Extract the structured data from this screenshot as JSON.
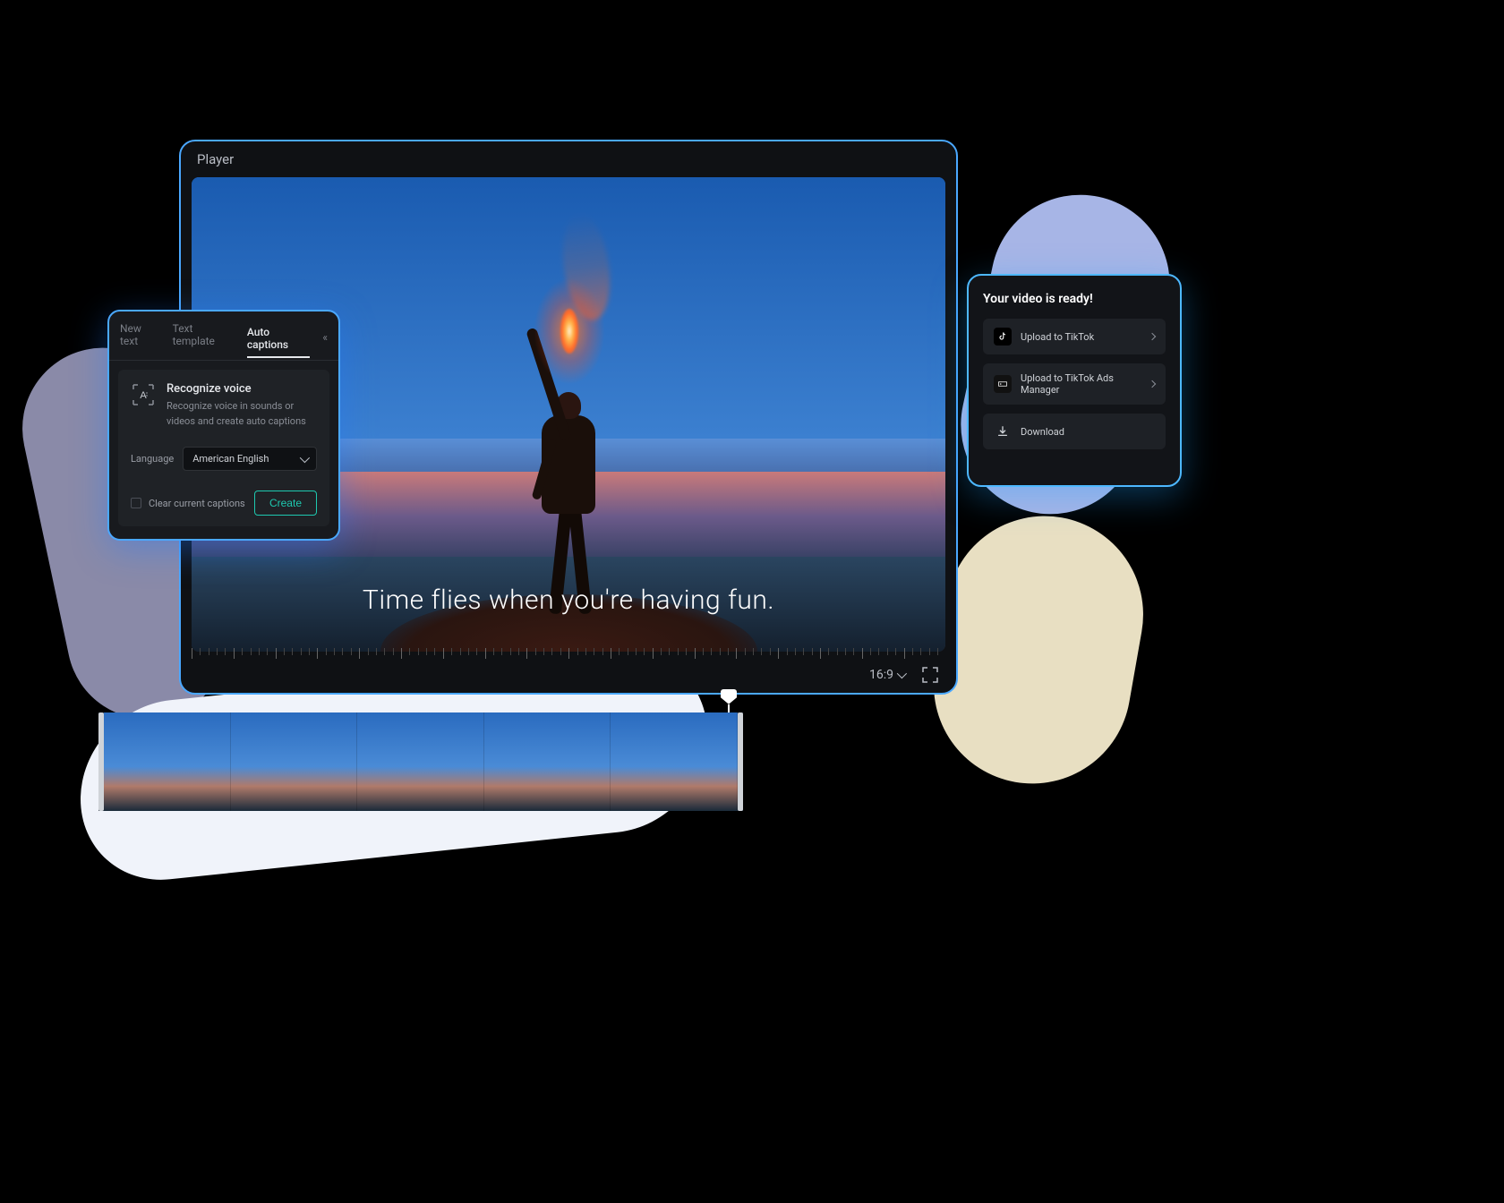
{
  "player": {
    "title": "Player",
    "caption": "Time flies when you're having fun.",
    "aspect_ratio": "16:9"
  },
  "captions_panel": {
    "tabs": [
      "New text",
      "Text template",
      "Auto captions"
    ],
    "active_tab": "Auto captions",
    "recognize": {
      "title": "Recognize voice",
      "description": "Recognize voice in sounds or videos and create auto captions"
    },
    "language_label": "Language",
    "language_value": "American English",
    "clear_label": "Clear current captions",
    "create_label": "Create"
  },
  "export_panel": {
    "title": "Your video is ready!",
    "items": [
      {
        "label": "Upload to TikTok",
        "icon": "tiktok",
        "chevron": true
      },
      {
        "label": "Upload to TikTok Ads Manager",
        "icon": "tiktok-ads",
        "chevron": true
      },
      {
        "label": "Download",
        "icon": "download",
        "chevron": false
      }
    ]
  },
  "colors": {
    "accent_border": "#4aa8ff",
    "create_button": "#1ec9b0"
  }
}
